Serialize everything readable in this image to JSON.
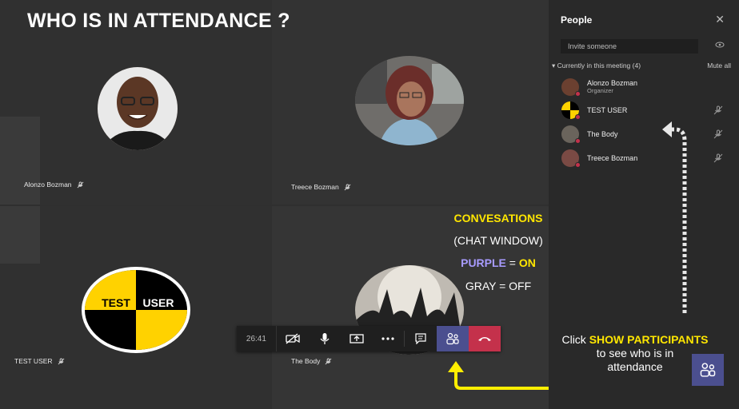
{
  "overlay_title": "WHO IS IN ATTENDANCE ?",
  "tiles": [
    {
      "name": "Alonzo Bozman"
    },
    {
      "name": "Treece Bozman"
    },
    {
      "name": "TEST USER"
    },
    {
      "name": "The Body"
    }
  ],
  "test_logo": {
    "left": "TEST",
    "right": "USER"
  },
  "annotation": {
    "line1": "CONVESATIONS",
    "line2": "(CHAT WINDOW)",
    "line3_purple": "PURPLE",
    "line3_eq": " = ",
    "line3_on": "ON",
    "line4": "GRAY = OFF"
  },
  "toolbar": {
    "timer": "26:41",
    "buttons": [
      "video-off-icon",
      "mic-icon",
      "share-screen-icon",
      "more-icon",
      "chat-icon",
      "people-icon",
      "hang-up-icon"
    ]
  },
  "panel": {
    "title": "People",
    "invite_placeholder": "Invite someone",
    "section_label": "Currently in this meeting  (4)",
    "mute_all": "Mute all",
    "participants": [
      {
        "name": "Alonzo Bozman",
        "role": "Organizer"
      },
      {
        "name": "TEST USER",
        "role": ""
      },
      {
        "name": "The Body",
        "role": ""
      },
      {
        "name": "Treece Bozman",
        "role": ""
      }
    ]
  },
  "hint": {
    "prefix": "Click ",
    "highlight": "SHOW PARTICIPANTS",
    "rest": "to see who is in attendance"
  },
  "colors": {
    "accent_purple": "#4b4f8f",
    "hangup_red": "#c4314b",
    "highlight_yellow": "#ffe600"
  }
}
